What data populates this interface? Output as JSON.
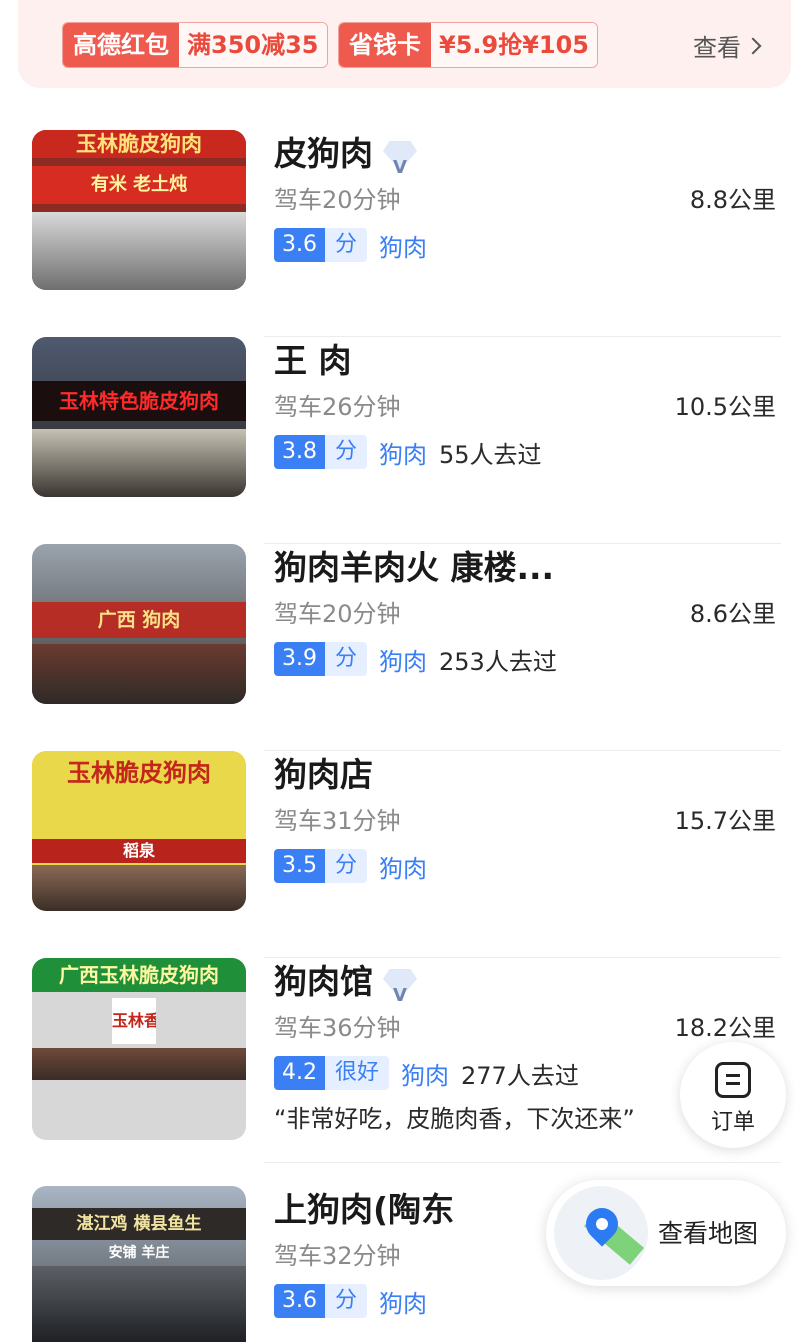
{
  "promo": {
    "coupon1_tag": "高德红包",
    "coupon1_value": "满350减35",
    "coupon2_tag": "省钱卡",
    "coupon2_value": "¥5.9抢¥105",
    "more_label": "查看"
  },
  "results": [
    {
      "title": "皮狗肉",
      "verified": true,
      "drive": "驾车20分钟",
      "distance": "8.8公里",
      "score": "3.6",
      "score_label": "分",
      "category": "狗肉",
      "visits": "",
      "quote": "",
      "sign_text": "玉林脆皮狗肉",
      "sign_text2": "有米 老土炖"
    },
    {
      "title": "王 肉",
      "verified": false,
      "drive": "驾车26分钟",
      "distance": "10.5公里",
      "score": "3.8",
      "score_label": "分",
      "category": "狗肉",
      "visits": "55人去过",
      "quote": "",
      "sign_text": "玉林特色脆皮狗肉",
      "sign_text2": ""
    },
    {
      "title": "狗肉羊肉火 康楼...",
      "verified": false,
      "drive": "驾车20分钟",
      "distance": "8.6公里",
      "score": "3.9",
      "score_label": "分",
      "category": "狗肉",
      "visits": "253人去过",
      "quote": "",
      "sign_text": "广西 狗肉",
      "sign_text2": ""
    },
    {
      "title": "狗肉店",
      "verified": false,
      "drive": "驾车31分钟",
      "distance": "15.7公里",
      "score": "3.5",
      "score_label": "分",
      "category": "狗肉",
      "visits": "",
      "quote": "",
      "sign_text": "玉林脆皮狗肉",
      "sign_text2": "稻泉"
    },
    {
      "title": "狗肉馆",
      "verified": true,
      "drive": "驾车36分钟",
      "distance": "18.2公里",
      "score": "4.2",
      "score_label": "很好",
      "category": "狗肉",
      "visits": "277人去过",
      "quote": "“非常好吃，皮脆肉香，下次还来”",
      "sign_text": "广西玉林脆皮狗肉",
      "sign_text2": "玉林香肉"
    },
    {
      "title": "上狗肉(陶东",
      "verified": false,
      "drive": "驾车32分钟",
      "distance": "",
      "score": "3.6",
      "score_label": "分",
      "category": "狗肉",
      "visits": "",
      "quote": "",
      "sign_text": "湛江鸡 横县鱼生",
      "sign_text2": "安铺 羊庄"
    }
  ],
  "fab_order": {
    "label": "订单"
  },
  "fab_map": {
    "label": "查看地图"
  },
  "colors": {
    "accent_blue": "#3b7ff5",
    "promo_red": "#ef5a4f"
  }
}
